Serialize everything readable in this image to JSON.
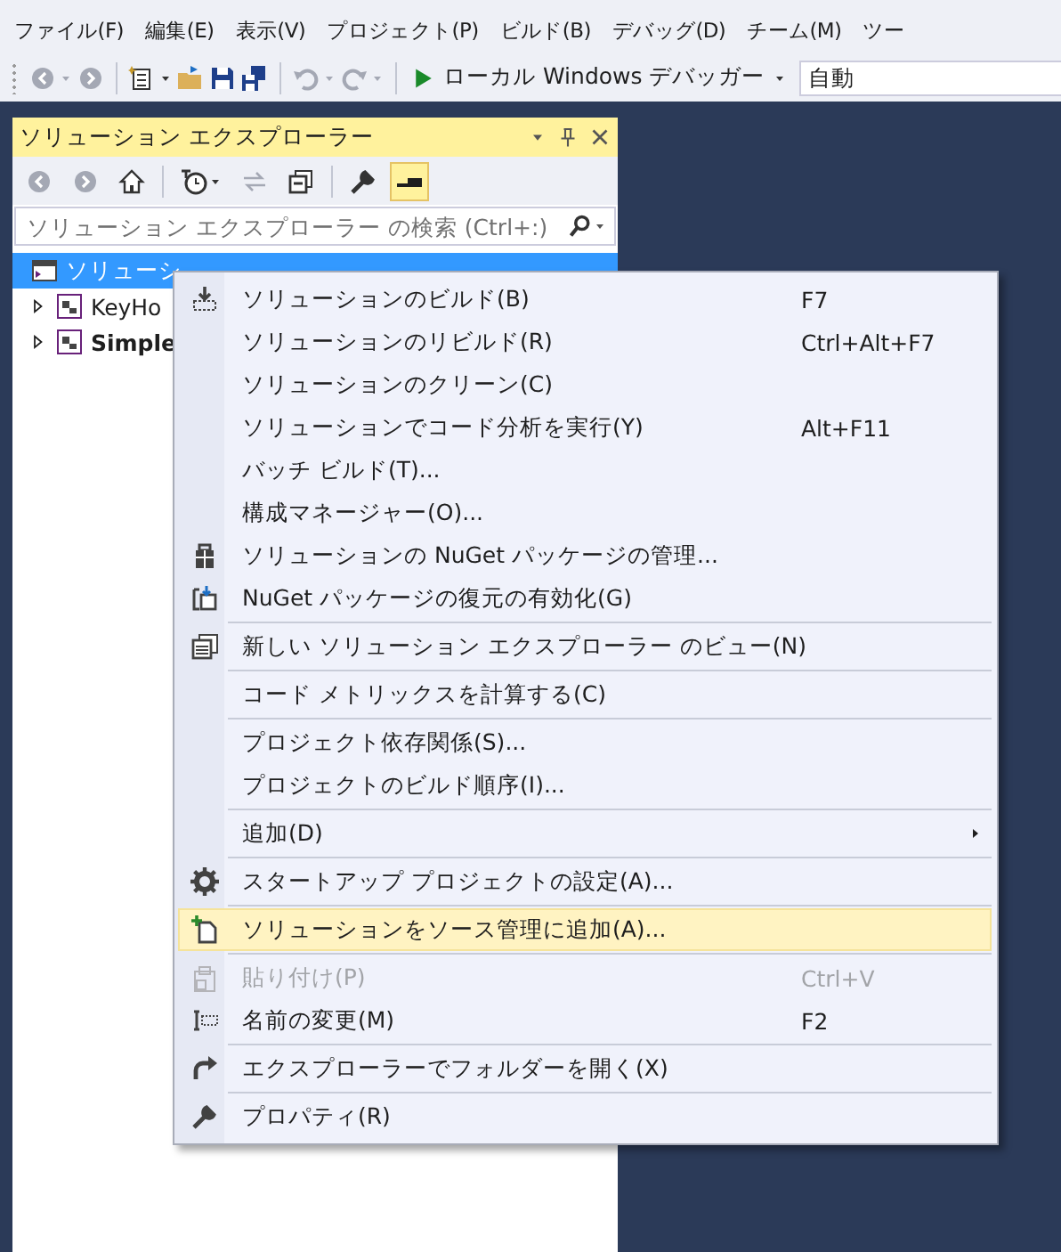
{
  "menubar": [
    {
      "label": "ファイル(F)"
    },
    {
      "label": "編集(E)"
    },
    {
      "label": "表示(V)"
    },
    {
      "label": "プロジェクト(P)"
    },
    {
      "label": "ビルド(B)"
    },
    {
      "label": "デバッグ(D)"
    },
    {
      "label": "チーム(M)"
    },
    {
      "label": "ツー"
    }
  ],
  "toolbar": {
    "buttons": [
      {
        "kind": "back",
        "disabled": true
      },
      {
        "kind": "forward",
        "disabled": true
      },
      {
        "kind": "sep"
      },
      {
        "kind": "newproject"
      },
      {
        "kind": "open"
      },
      {
        "kind": "save"
      },
      {
        "kind": "saveall"
      },
      {
        "kind": "sep"
      },
      {
        "kind": "undo",
        "disabled": true
      },
      {
        "kind": "redo",
        "disabled": true
      },
      {
        "kind": "sep"
      }
    ],
    "debugger": "ローカル Windows デバッガー",
    "config": "自動"
  },
  "explorer": {
    "title": "ソリューション エクスプローラー",
    "tools": [
      {
        "kind": "back",
        "disabled": true,
        "selected": false
      },
      {
        "kind": "forward",
        "disabled": true,
        "selected": false
      },
      {
        "kind": "home",
        "selected": false
      },
      {
        "kind": "sep"
      },
      {
        "kind": "history",
        "selected": false
      },
      {
        "kind": "sync",
        "disabled": true,
        "selected": false
      },
      {
        "kind": "collapse",
        "selected": false
      },
      {
        "kind": "sep"
      },
      {
        "kind": "properties",
        "selected": false
      },
      {
        "kind": "preview",
        "selected": true
      }
    ],
    "search": {
      "placeholder": "ソリューション エクスプローラー の検索 (Ctrl+:)"
    },
    "tree": [
      {
        "label": "ソリューシ",
        "kind": "solution",
        "selected": true,
        "startup": false,
        "children": [
          {
            "label": "KeyHo",
            "kind": "project",
            "selected": false,
            "startup": false,
            "expanded": false
          },
          {
            "label": "Simple",
            "kind": "project",
            "selected": false,
            "startup": true,
            "expanded": false
          }
        ]
      }
    ]
  },
  "context_menu": [
    {
      "kind": "item",
      "label": "ソリューションのビルド(B)",
      "shortcut": "F7",
      "disabled": false,
      "selected": false
    },
    {
      "kind": "item",
      "label": "ソリューションのリビルド(R)",
      "shortcut": "Ctrl+Alt+F7",
      "disabled": false,
      "selected": false
    },
    {
      "kind": "item",
      "label": "ソリューションのクリーン(C)",
      "disabled": false,
      "selected": false
    },
    {
      "kind": "item",
      "label": "ソリューションでコード分析を実行(Y)",
      "shortcut": "Alt+F11",
      "disabled": false,
      "selected": false
    },
    {
      "kind": "item",
      "label": "バッチ ビルド(T)...",
      "disabled": false,
      "selected": false
    },
    {
      "kind": "item",
      "label": "構成マネージャー(O)...",
      "disabled": false,
      "selected": false
    },
    {
      "kind": "item",
      "label": "ソリューションの NuGet パッケージの管理...",
      "disabled": false,
      "selected": false
    },
    {
      "kind": "item",
      "label": "NuGet パッケージの復元の有効化(G)",
      "disabled": false,
      "selected": false
    },
    {
      "kind": "separator"
    },
    {
      "kind": "item",
      "label": "新しい ソリューション エクスプローラー のビュー(N)",
      "disabled": false,
      "selected": false
    },
    {
      "kind": "separator"
    },
    {
      "kind": "item",
      "label": "コード メトリックスを計算する(C)",
      "disabled": false,
      "selected": false
    },
    {
      "kind": "separator"
    },
    {
      "kind": "item",
      "label": "プロジェクト依存関係(S)...",
      "disabled": false,
      "selected": false
    },
    {
      "kind": "item",
      "label": "プロジェクトのビルド順序(I)...",
      "disabled": false,
      "selected": false
    },
    {
      "kind": "separator"
    },
    {
      "kind": "item",
      "label": "追加(D)",
      "submenu": true,
      "disabled": false,
      "selected": false
    },
    {
      "kind": "separator"
    },
    {
      "kind": "item",
      "label": "スタートアップ プロジェクトの設定(A)...",
      "disabled": false,
      "selected": false
    },
    {
      "kind": "separator"
    },
    {
      "kind": "item",
      "label": "ソリューションをソース管理に追加(A)...",
      "disabled": false,
      "selected": true
    },
    {
      "kind": "separator"
    },
    {
      "kind": "item",
      "label": "貼り付け(P)",
      "shortcut": "Ctrl+V",
      "disabled": true,
      "selected": false
    },
    {
      "kind": "item",
      "label": "名前の変更(M)",
      "shortcut": "F2",
      "disabled": false,
      "selected": false
    },
    {
      "kind": "separator"
    },
    {
      "kind": "item",
      "label": "エクスプローラーでフォルダーを開く(X)",
      "disabled": false,
      "selected": false
    },
    {
      "kind": "separator"
    },
    {
      "kind": "item",
      "label": "プロパティ(R)",
      "disabled": false,
      "selected": false
    }
  ]
}
